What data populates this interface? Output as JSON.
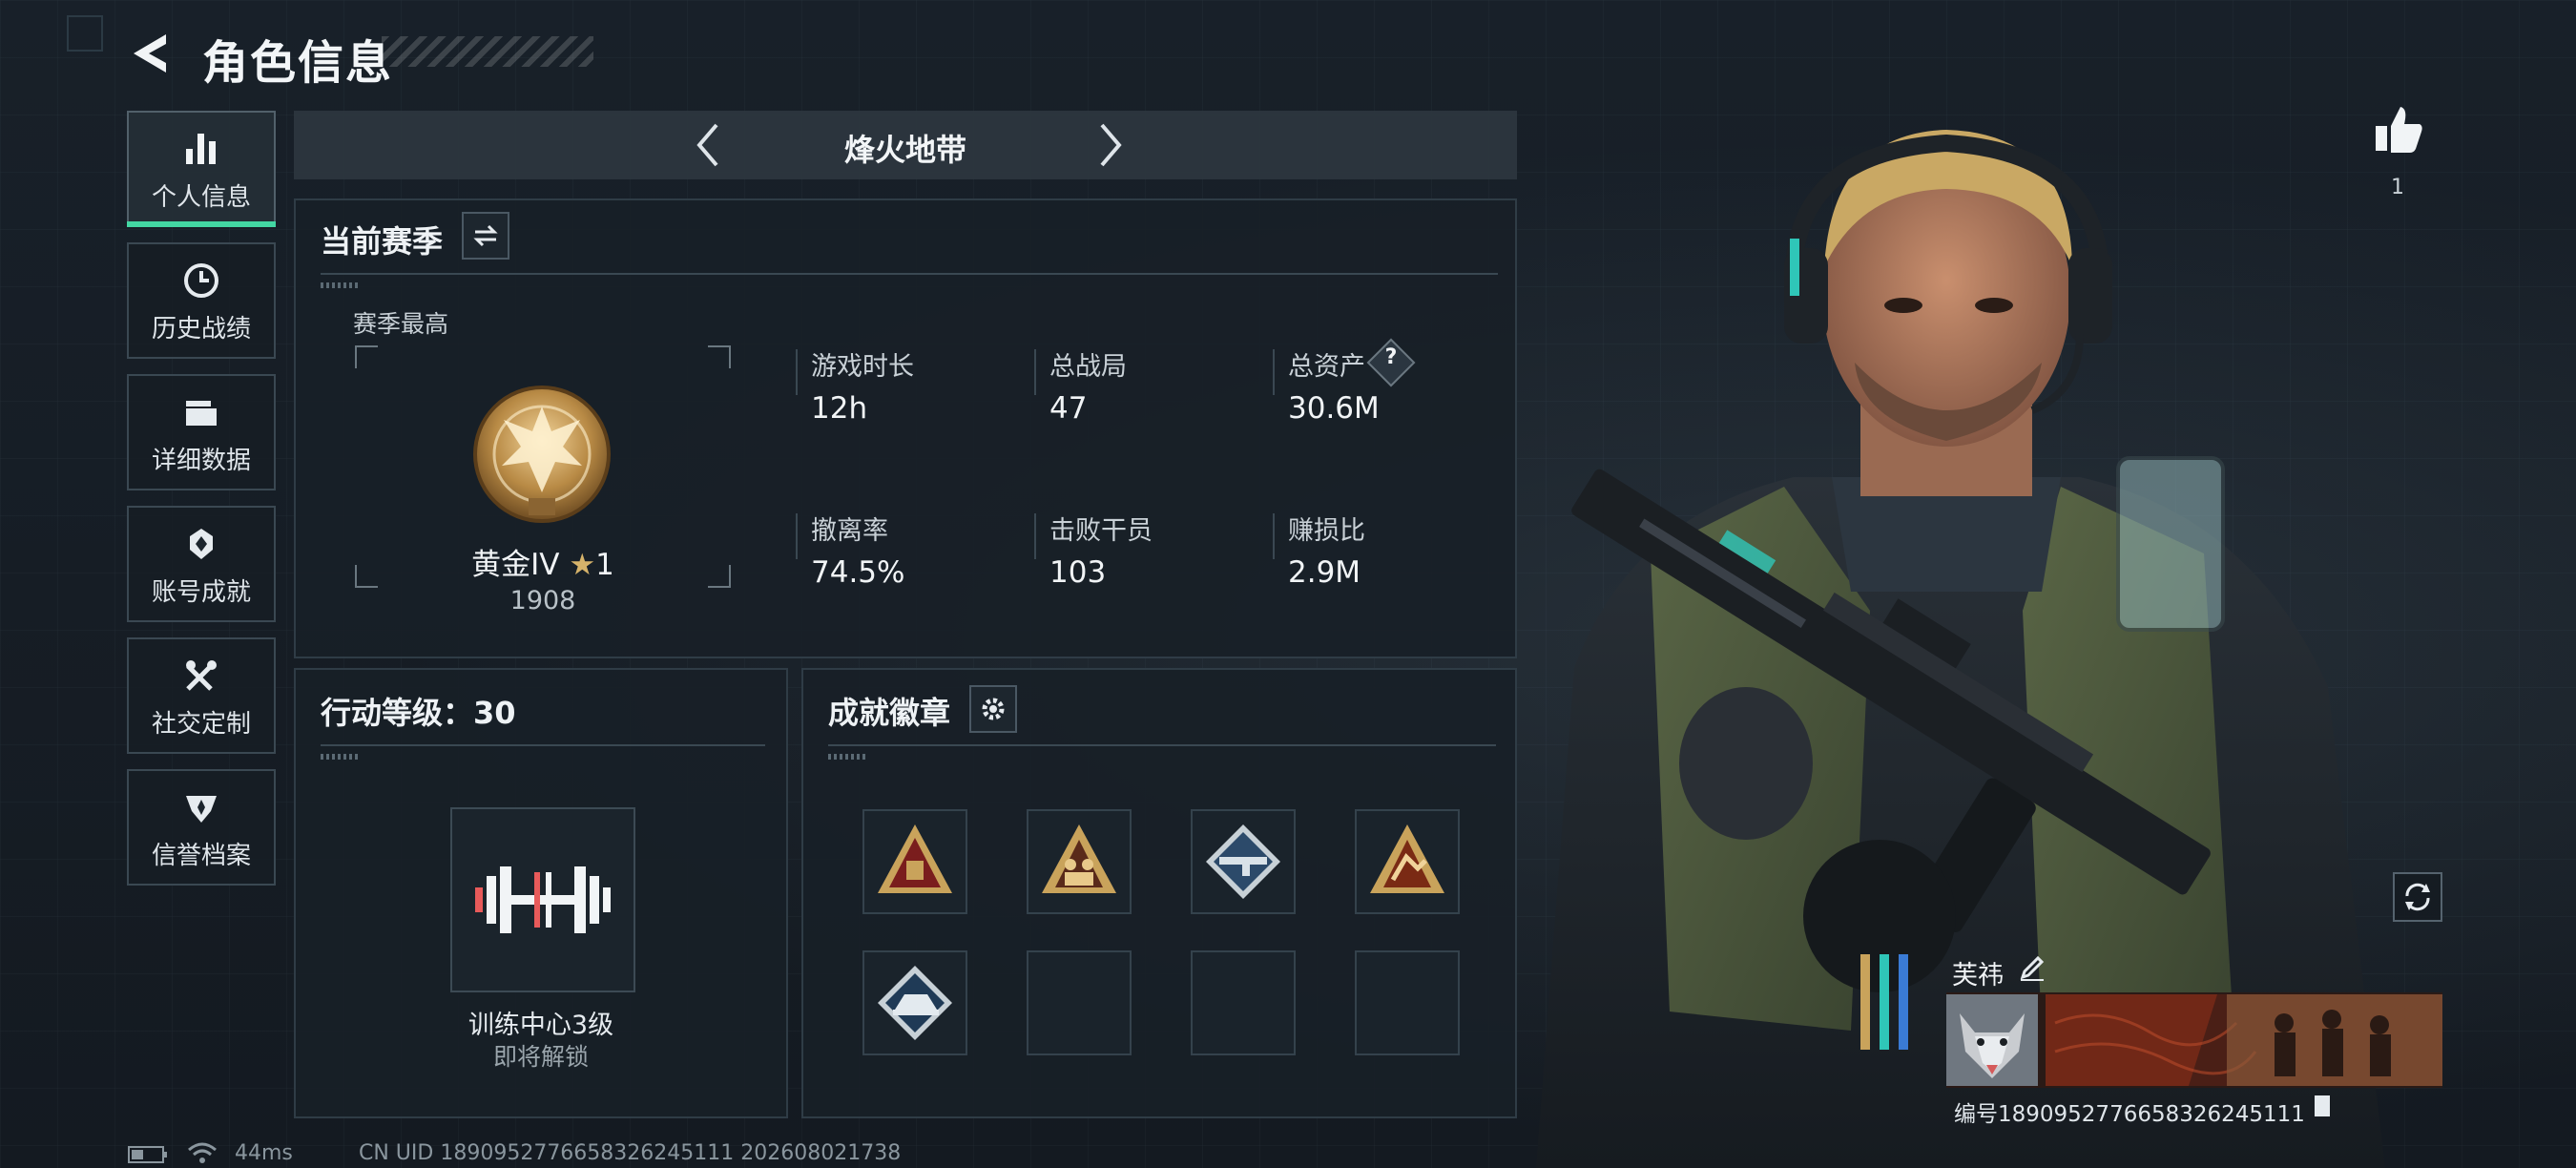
{
  "header": {
    "title": "角色信息"
  },
  "sidebar": {
    "items": [
      {
        "label": "个人信息",
        "icon": "bar-chart-icon",
        "active": true
      },
      {
        "label": "历史战绩",
        "icon": "clock-icon"
      },
      {
        "label": "详细数据",
        "icon": "folder-icon"
      },
      {
        "label": "账号成就",
        "icon": "achievement-badge-icon"
      },
      {
        "label": "社交定制",
        "icon": "tools-icon"
      },
      {
        "label": "信誉档案",
        "icon": "shield-wings-icon"
      }
    ]
  },
  "mode": {
    "title": "烽火地带"
  },
  "season": {
    "title": "当前赛季",
    "best_label": "赛季最高",
    "rank": {
      "name": "黄金IV",
      "stars": "1",
      "score": "1908"
    },
    "stats": [
      {
        "label": "游戏时长",
        "value": "12h"
      },
      {
        "label": "总战局",
        "value": "47"
      },
      {
        "label": "总资产",
        "value": "30.6M",
        "help": "?"
      },
      {
        "label": "撤离率",
        "value": "74.5%"
      },
      {
        "label": "击败干员",
        "value": "103"
      },
      {
        "label": "赚损比",
        "value": "2.9M"
      }
    ]
  },
  "action_level": {
    "title": "行动等级：30",
    "facility": "训练中心3级",
    "status": "即将解锁"
  },
  "badges": {
    "title": "成就徽章",
    "slots": [
      {
        "icon": "gold-triangle-badge-icon",
        "filled": true
      },
      {
        "icon": "gold-squad-badge-icon",
        "filled": true
      },
      {
        "icon": "silver-rifle-badge-icon",
        "filled": true
      },
      {
        "icon": "gold-sprint-badge-icon",
        "filled": true
      },
      {
        "icon": "silver-vehicle-badge-icon",
        "filled": true
      },
      {
        "filled": false
      },
      {
        "filled": false
      },
      {
        "filled": false
      }
    ]
  },
  "character": {
    "likes": "1",
    "name": "芙祎",
    "player_id": "编号1890952776658326245111"
  },
  "status_bar": {
    "ping": "44ms",
    "uid": "CN UID 1890952776658326245111 202608021738"
  },
  "colors": {
    "accent": "#43d7a3",
    "gold": "#c9a35b",
    "panel": "#18202a"
  }
}
